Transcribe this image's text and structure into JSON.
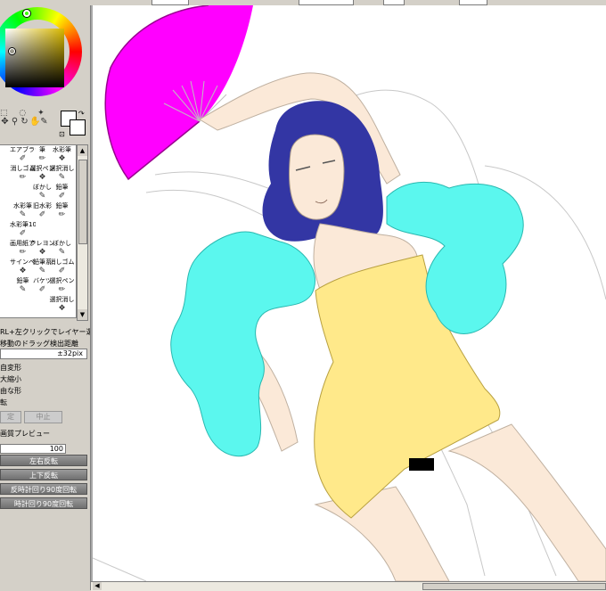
{
  "app": {
    "colors": {
      "panel_bg": "#d4d0c8",
      "fan_magenta": "#ff00ff",
      "boa_cyan": "#5bf7ee",
      "dress_yellow": "#ffe98a",
      "hair_blue": "#3336a4",
      "skin": "#fbe9d8"
    }
  },
  "brush_grid": [
    [
      "",
      "エアブラシ",
      "筆",
      "水彩筆"
    ],
    [
      "",
      "消しゴム",
      "選択ペン",
      "選択消し"
    ],
    [
      "",
      "",
      "ぼかし",
      "鉛筆"
    ],
    [
      "",
      "水彩筆",
      "旧水彩",
      "鉛筆"
    ],
    [
      "",
      "水彩筆10筋",
      "",
      ""
    ],
    [
      "",
      "画用紙アクリル",
      "クレヨン",
      "ぼかし"
    ],
    [
      "",
      "サインペン",
      "鉛筆系",
      "消しゴム"
    ],
    [
      "",
      "鉛筆",
      "バケツ",
      "選択ペン"
    ],
    [
      "",
      "",
      "",
      "選択消し"
    ]
  ],
  "options": {
    "ctrl_click_label": "RL+左クリックでレイヤー選択",
    "drag_label": "移動のドラッグ検出距離",
    "drag_value": "±32pix",
    "check_items": [
      "自変形",
      "大縮小",
      "由な形",
      "転"
    ],
    "ok_label": "定",
    "cancel_label": "中止",
    "preview_label": "画質プレビュー",
    "preview_value": "100"
  },
  "transform_buttons": [
    "左右反転",
    "上下反転",
    "反時計回り90度回転",
    "時計回り90度回転"
  ]
}
